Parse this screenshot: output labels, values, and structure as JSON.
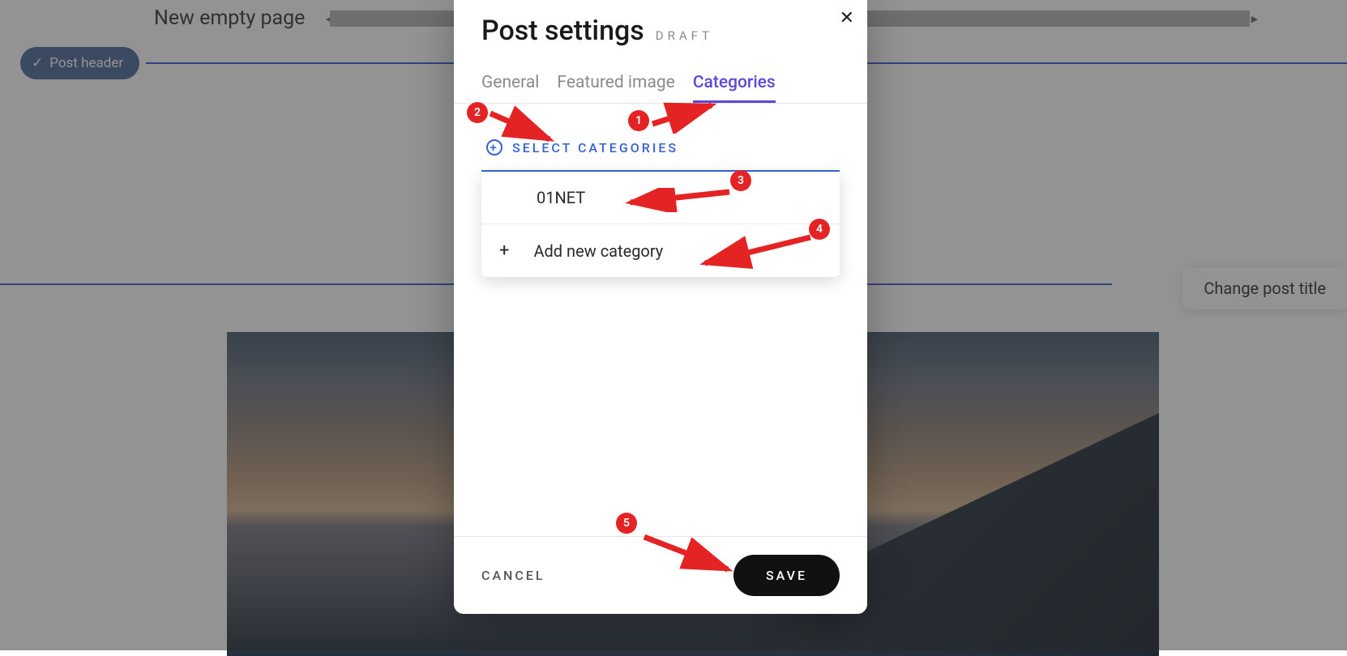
{
  "background": {
    "new_page_label": "New empty page",
    "post_header_chip": "Post header",
    "change_title_button": "Change post title"
  },
  "modal": {
    "title": "Post settings",
    "status": "DRAFT",
    "tabs": {
      "general": "General",
      "featured_image": "Featured image",
      "categories": "Categories"
    },
    "select_categories_label": "SELECT CATEGORIES",
    "dropdown": {
      "item1": "01NET",
      "add_new": "Add new category"
    },
    "footer": {
      "cancel": "CANCEL",
      "save": "SAVE"
    }
  },
  "annotations": {
    "n1": "1",
    "n2": "2",
    "n3": "3",
    "n4": "4",
    "n5": "5"
  }
}
